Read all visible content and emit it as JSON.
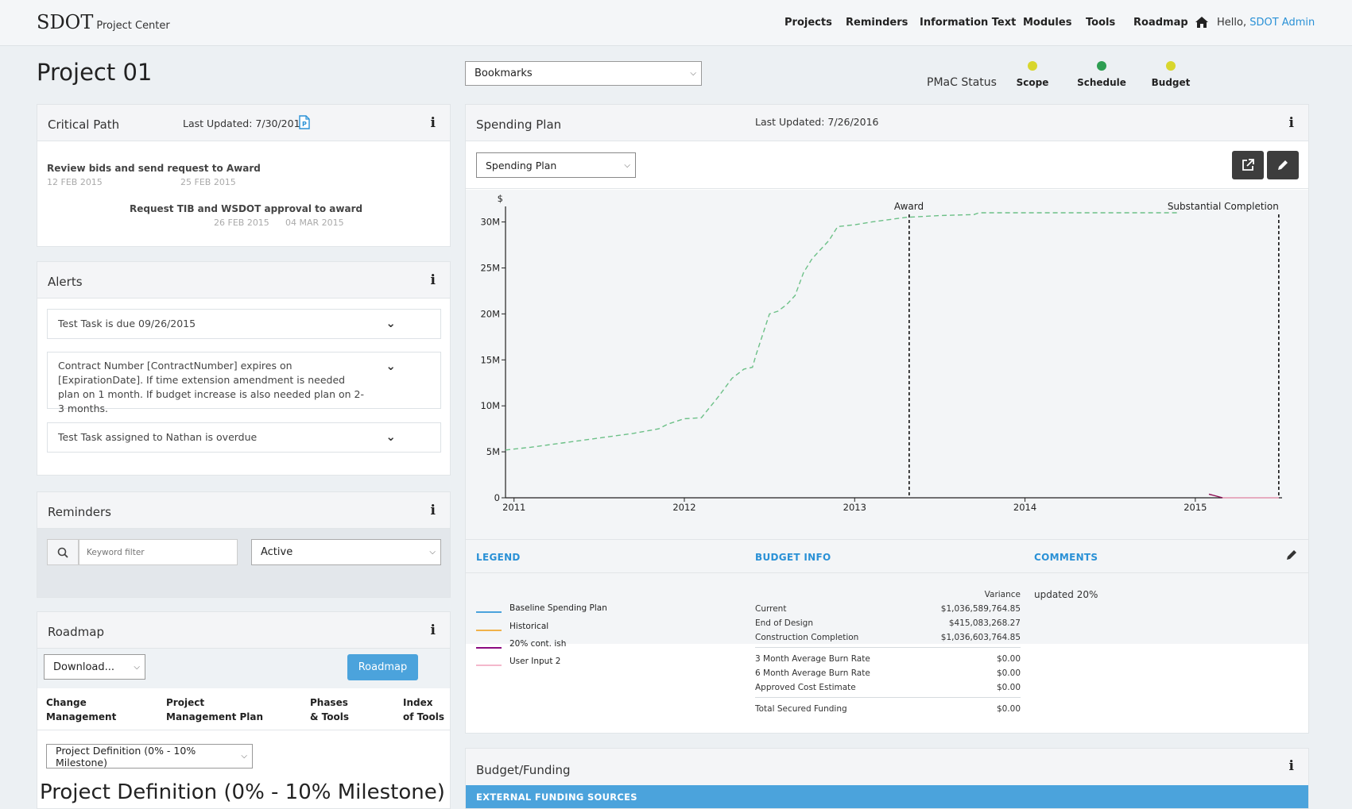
{
  "header": {
    "logo": "SDOT",
    "logo_sub": "Project Center",
    "nav": [
      "Projects",
      "Reminders",
      "Information Text",
      "Modules",
      "Tools",
      "Roadmap"
    ],
    "hello": "Hello,",
    "user": "SDOT Admin"
  },
  "page": {
    "title": "Project 01",
    "bookmarks": "Bookmarks"
  },
  "pmac": {
    "label": "PMaC Status",
    "items": [
      {
        "label": "Scope",
        "color": "#d8d62d"
      },
      {
        "label": "Schedule",
        "color": "#2e9e52"
      },
      {
        "label": "Budget",
        "color": "#d8d62d"
      }
    ]
  },
  "critical_path": {
    "title": "Critical Path",
    "updated": "Last Updated: 7/30/2015",
    "tasks": [
      {
        "name": "Review bids and send request to Award",
        "start": "12 FEB 2015",
        "end": "25 FEB 2015"
      },
      {
        "name": "Request TIB and WSDOT approval to award",
        "start": "26 FEB 2015",
        "end": "04 MAR 2015"
      }
    ]
  },
  "alerts": {
    "title": "Alerts",
    "items": [
      "Test Task is due 09/26/2015",
      "Contract Number [ContractNumber] expires on [ExpirationDate]. If time extension amendment is needed plan on 1 month. If budget increase is also needed plan on 2-3 months.",
      "Test Task assigned to Nathan is overdue"
    ]
  },
  "reminders": {
    "title": "Reminders",
    "placeholder": "Keyword filter",
    "status": "Active"
  },
  "roadmap": {
    "title": "Roadmap",
    "download": "Download...",
    "button": "Roadmap",
    "columns": [
      [
        "Change",
        "Management"
      ],
      [
        "Project",
        "Management Plan"
      ],
      [
        "Phases",
        "& Tools"
      ],
      [
        "Index",
        "of Tools"
      ]
    ],
    "phase_select": "Project Definition (0% - 10% Milestone)",
    "phase_heading": "Project Definition (0% - 10% Milestone)"
  },
  "spending": {
    "title": "Spending Plan",
    "updated": "Last Updated: 7/26/2016",
    "view": "Spending Plan"
  },
  "chart_data": {
    "type": "line",
    "ylabel": "$",
    "y_ticks": [
      "0",
      "5M",
      "10M",
      "15M",
      "20M",
      "25M",
      "30M"
    ],
    "x_ticks": [
      "2011",
      "2012",
      "2013",
      "2014",
      "2015"
    ],
    "ylim": [
      0,
      31000000
    ],
    "xlim": [
      2010.95,
      2015.5
    ],
    "markers": [
      {
        "label": "Award",
        "x": 2013.32
      },
      {
        "label": "Substantial Completion",
        "x": 2015.49
      }
    ],
    "series": [
      {
        "color": "#6cc087",
        "style": "dashed",
        "x": [
          2010.95,
          2011.1,
          2011.3,
          2011.5,
          2011.7,
          2011.85,
          2011.9,
          2012.0,
          2012.1,
          2012.2,
          2012.28,
          2012.35,
          2012.4,
          2012.42,
          2012.5,
          2012.55,
          2012.6,
          2012.65,
          2012.7,
          2012.75,
          2012.85,
          2012.9,
          2013.0,
          2013.1,
          2013.3,
          2013.5,
          2013.7,
          2013.73,
          2014.0,
          2014.5,
          2014.9
        ],
        "y": [
          5200000,
          5500000,
          6000000,
          6500000,
          7000000,
          7500000,
          8000000,
          8600000,
          8700000,
          11000000,
          13000000,
          14000000,
          14200000,
          15500000,
          20000000,
          20300000,
          21000000,
          22000000,
          24500000,
          26000000,
          28000000,
          29500000,
          29700000,
          30000000,
          30500000,
          30700000,
          30800000,
          31000000,
          31000000,
          31000000,
          31000000
        ]
      },
      {
        "color": "#8b0a50",
        "style": "solid",
        "x": [
          2015.08,
          2015.16
        ],
        "y": [
          400000,
          0
        ]
      },
      {
        "color": "#f4a6c0",
        "style": "solid",
        "x": [
          2015.16,
          2015.49
        ],
        "y": [
          0,
          0
        ]
      }
    ]
  },
  "legend": {
    "title": "LEGEND",
    "items": [
      {
        "label": "Baseline Spending Plan",
        "color": "#4ba3dc"
      },
      {
        "label": "Historical",
        "color": "#f0b24a"
      },
      {
        "label": "20% cont. ish",
        "color": "#8b0a80"
      },
      {
        "label": "User Input 2",
        "color": "#f4b8cc"
      }
    ]
  },
  "budget_info": {
    "title": "BUDGET INFO",
    "variance_label": "Variance",
    "rows": [
      {
        "label": "Current",
        "value": "$1,036,589,764.85"
      },
      {
        "label": "End of Design",
        "value": "$415,083,268.27"
      },
      {
        "label": "Construction Completion",
        "value": "$1,036,603,764.85"
      },
      {
        "label": "3 Month Average Burn Rate",
        "value": "$0.00"
      },
      {
        "label": "6 Month Average Burn Rate",
        "value": "$0.00"
      },
      {
        "label": "Approved Cost Estimate",
        "value": "$0.00"
      },
      {
        "label": "Total Secured Funding",
        "value": "$0.00"
      }
    ]
  },
  "comments": {
    "title": "COMMENTS",
    "text": "updated 20%"
  },
  "budget_funding": {
    "title": "Budget/Funding",
    "bar": "EXTERNAL FUNDING SOURCES"
  }
}
